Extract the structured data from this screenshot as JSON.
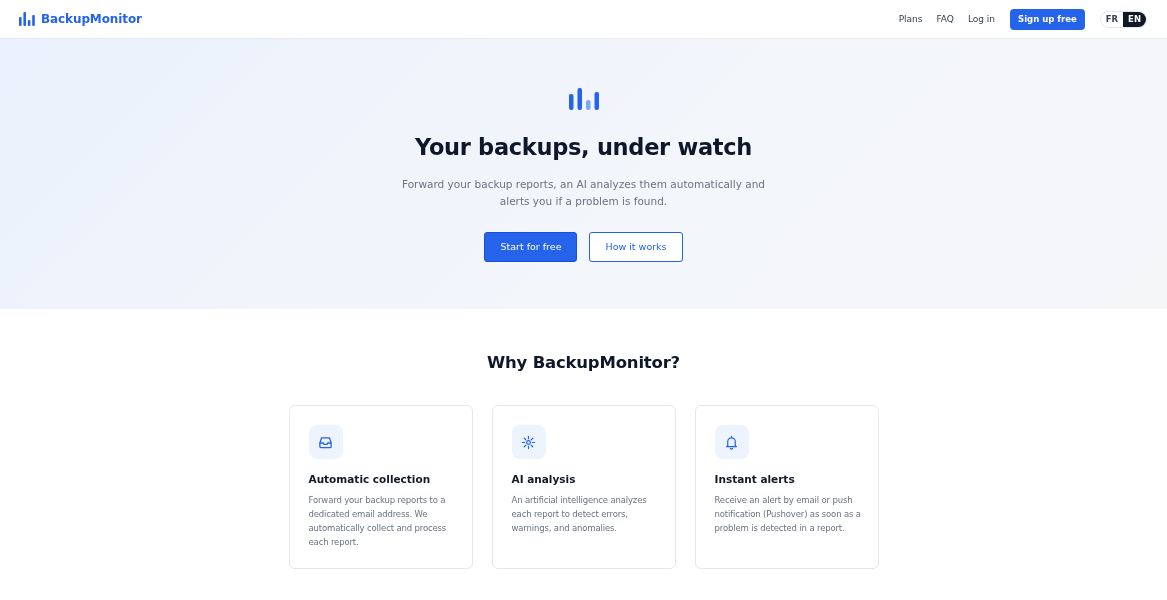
{
  "header": {
    "logo": "BackupMonitor",
    "nav": [
      {
        "label": "Plans"
      },
      {
        "label": "FAQ"
      },
      {
        "label": "Log in"
      }
    ],
    "cta": "Sign up free",
    "languages": [
      {
        "label": "FR",
        "selected": false
      },
      {
        "label": "EN",
        "selected": true
      }
    ]
  },
  "hero": {
    "title": "Your backups, under watch",
    "subtitle": "Forward your backup reports, an AI analyzes them automatically and alerts you if a problem is found.",
    "buttons": [
      {
        "label": "Start for free",
        "kind": "primary"
      },
      {
        "label": "How it works",
        "kind": "outline"
      }
    ]
  },
  "features": {
    "title": "Why BackupMonitor?",
    "cards": [
      {
        "title": "Automatic collection",
        "text": "Forward your backup reports to a dedicated email address. We automatically collect and process each report."
      },
      {
        "title": "AI analysis",
        "text": "An artificial intelligence analyzes each report to detect errors, warnings, and anomalies."
      },
      {
        "title": "Instant alerts",
        "text": "Receive an alert by email or push notification (Pushover) as soon as a problem is detected in a report."
      }
    ]
  }
}
